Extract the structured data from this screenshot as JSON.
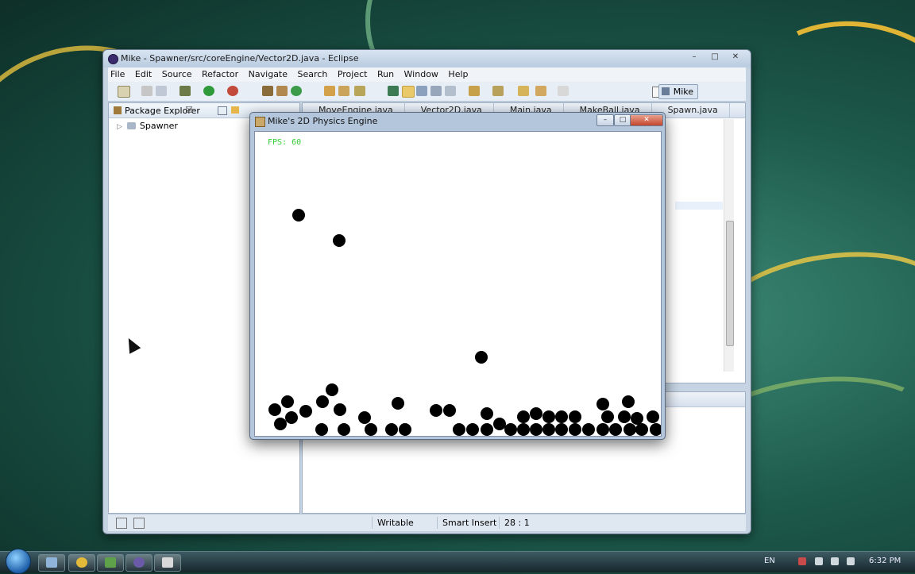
{
  "eclipse": {
    "title": "Mike - Spawner/src/coreEngine/Vector2D.java - Eclipse",
    "window_buttons": [
      "–",
      "□",
      "✕"
    ],
    "menu": [
      "File",
      "Edit",
      "Source",
      "Refactor",
      "Navigate",
      "Search",
      "Project",
      "Run",
      "Window",
      "Help"
    ],
    "perspective": "Mike",
    "package_explorer": {
      "label": "Package Explorer",
      "close": "☒",
      "items": [
        {
          "label": "Spawner",
          "expand": "▷"
        }
      ]
    },
    "editor_tabs": [
      "MoveEngine.java",
      "Vector2D.java",
      "Main.java",
      "MakeBall.java",
      "Spawn.java"
    ],
    "status": {
      "mode": "Writable",
      "insert": "Smart Insert",
      "position": "28 : 1"
    }
  },
  "physics_window": {
    "title": "Mike's 2D Physics Engine",
    "buttons": [
      "–",
      "□",
      "✕"
    ],
    "fps_label": "FPS: 60",
    "ball_color": "#000000",
    "fps_color": "#33cc33"
  },
  "taskbar": {
    "language": "EN",
    "time": "6:32 PM"
  }
}
